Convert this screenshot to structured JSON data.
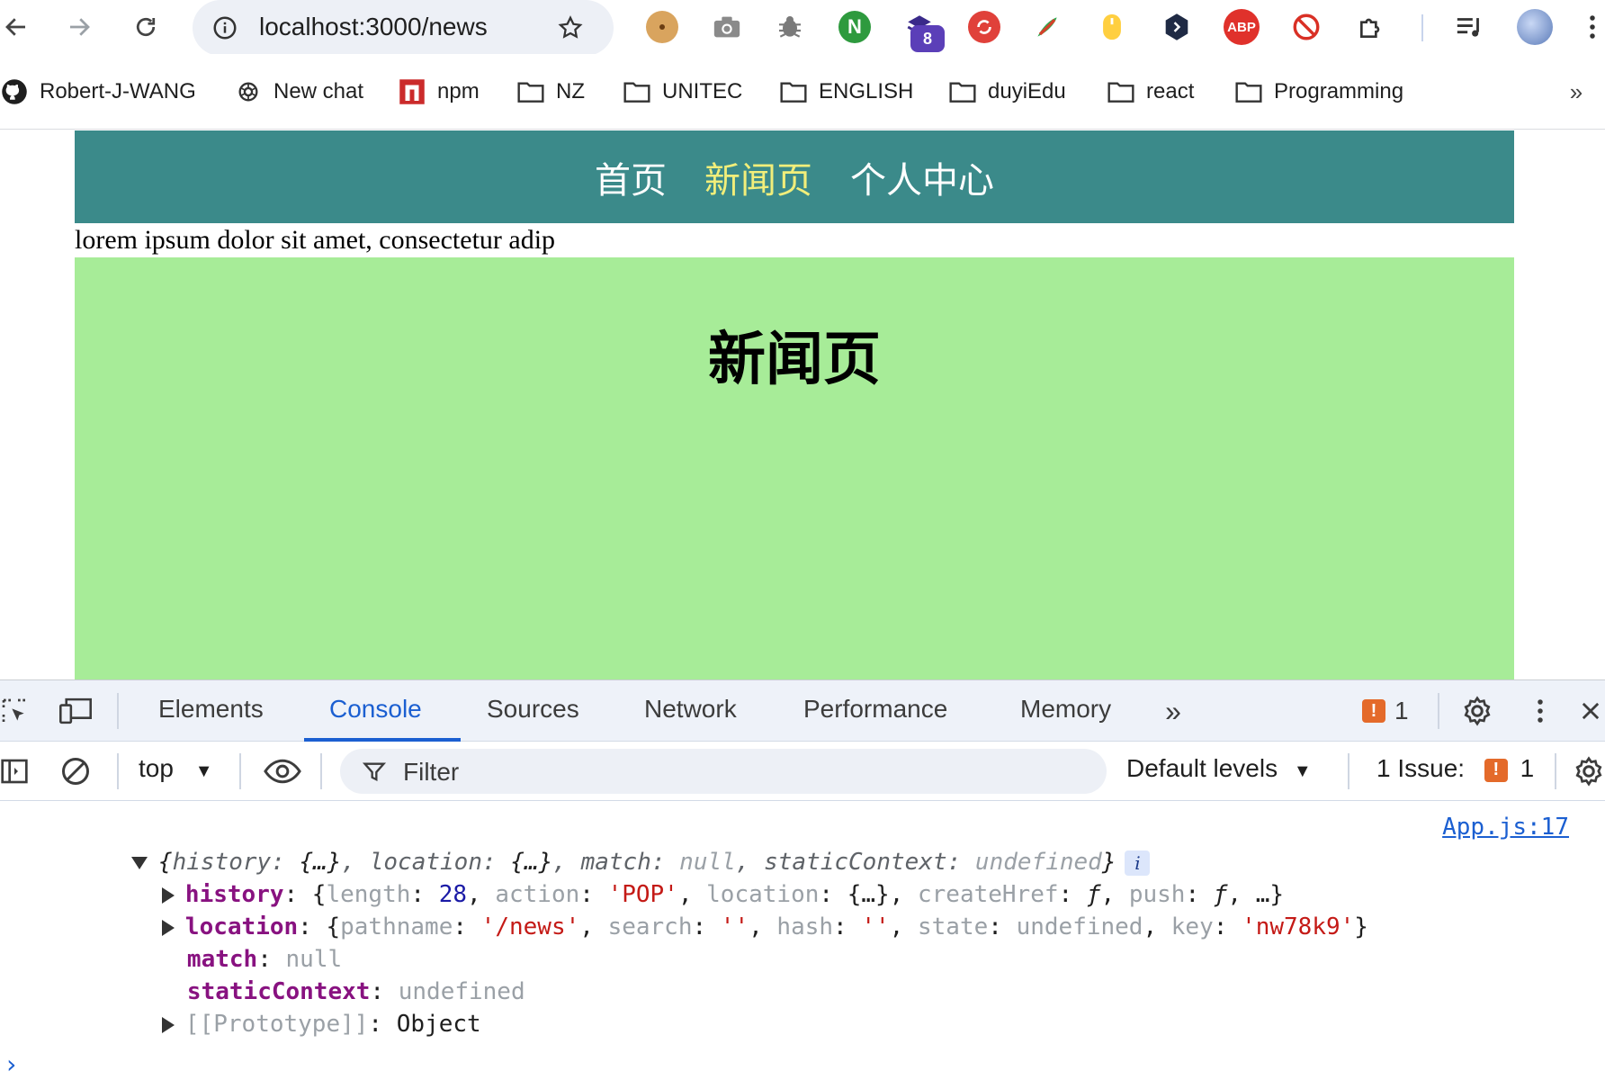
{
  "browser": {
    "url": "localhost:3000/news",
    "extension_badge": "8",
    "extensions": [
      "cookie-icon",
      "camera-icon",
      "bug-icon",
      "n-extension-icon",
      "stack-extension-icon",
      "sync-extension-icon",
      "feather-extension-icon",
      "mouse-extension-icon",
      "hex-extension-icon",
      "adblock-icon",
      "block-icon",
      "puzzle-icon"
    ],
    "adblock_label": "ABP"
  },
  "bookmarks": [
    {
      "label": "Robert-J-WANG",
      "icon": "github-icon"
    },
    {
      "label": "New chat",
      "icon": "openai-icon"
    },
    {
      "label": "npm",
      "icon": "npm-icon"
    },
    {
      "label": "NZ",
      "icon": "folder-icon"
    },
    {
      "label": "UNITEC",
      "icon": "folder-icon"
    },
    {
      "label": "ENGLISH",
      "icon": "folder-icon"
    },
    {
      "label": "duyiEdu",
      "icon": "folder-icon"
    },
    {
      "label": "react",
      "icon": "folder-icon"
    },
    {
      "label": "Programming",
      "icon": "folder-icon"
    }
  ],
  "page": {
    "nav": [
      "首页",
      "新闻页",
      "个人中心"
    ],
    "nav_active_index": 1,
    "nav_active_color": "#f1ee7a",
    "nav_bg_color": "#3b8a8a",
    "lorem": "lorem ipsum dolor sit amet, consectetur adip",
    "heading": "新闻页",
    "panel_color": "#a7ec98"
  },
  "devtools": {
    "tabs": [
      "Elements",
      "Console",
      "Sources",
      "Network",
      "Performance",
      "Memory"
    ],
    "active_tab": "Console",
    "warning_count": "1",
    "context": "top",
    "filter_placeholder": "Filter",
    "levels": "Default levels",
    "issues_label": "1 Issue:",
    "issues_count": "1",
    "source_link": "App.js:17",
    "log": {
      "summary": {
        "k1": "history",
        "v1": "{…}",
        "k2": "location",
        "v2": "{…}",
        "k3": "match",
        "v3": "null",
        "k4": "staticContext",
        "v4": "undefined"
      },
      "history": {
        "key": "history",
        "length_key": "length",
        "length_val": "28",
        "action_key": "action",
        "action_val": "'POP'",
        "location_key": "location",
        "location_val": "{…}",
        "createHref_key": "createHref",
        "createHref_val": "ƒ",
        "push_key": "push",
        "push_val": "ƒ",
        "tail": "…}"
      },
      "location": {
        "key": "location",
        "pathname_key": "pathname",
        "pathname_val": "'/news'",
        "search_key": "search",
        "search_val": "''",
        "hash_key": "hash",
        "hash_val": "''",
        "state_key": "state",
        "state_val": "undefined",
        "key_key": "key",
        "key_val": "'nw78k9'"
      },
      "match": {
        "key": "match",
        "val": "null"
      },
      "staticContext": {
        "key": "staticContext",
        "val": "undefined"
      },
      "prototype": {
        "key": "[[Prototype]]",
        "val": "Object"
      }
    },
    "prompt": "›"
  }
}
